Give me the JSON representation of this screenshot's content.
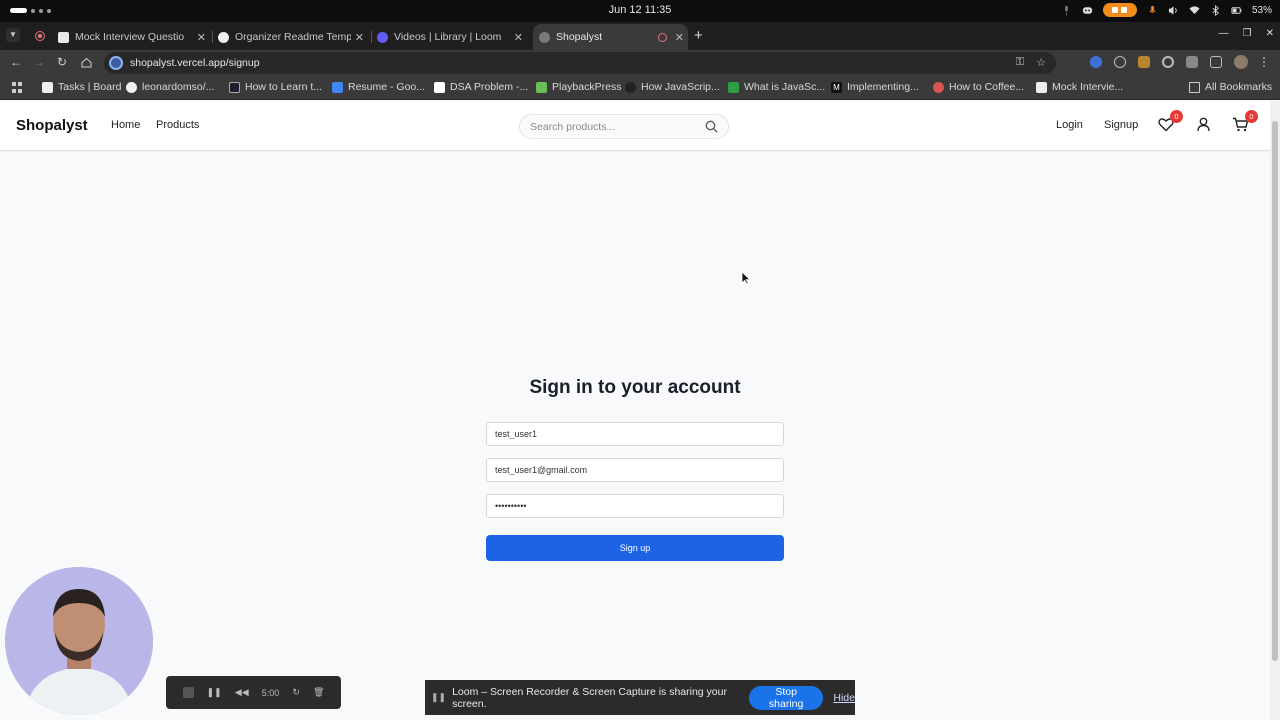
{
  "os": {
    "clock": "Jun 12  11:35",
    "battery": "53%"
  },
  "browser": {
    "tabs": [
      {
        "title": "Mock Interview Questio",
        "active": false
      },
      {
        "title": "Organizer Readme Temp",
        "active": false
      },
      {
        "title": "Videos | Library | Loom",
        "active": false
      },
      {
        "title": "Shopalyst",
        "active": true
      }
    ],
    "url": "shopalyst.vercel.app/signup",
    "bookmarks": [
      "Tasks | Board",
      "leonardomso/...",
      "How to Learn t...",
      "Resume - Goo...",
      "DSA Problem -...",
      "PlaybackPress",
      "How JavaScrip...",
      "What is JavaSc...",
      "Implementing...",
      "How to Coffee...",
      "Mock Intervie..."
    ],
    "all_bookmarks": "All Bookmarks"
  },
  "site": {
    "brand": "Shopalyst",
    "nav": {
      "home": "Home",
      "products": "Products"
    },
    "search_placeholder": "Search products...",
    "login": "Login",
    "signup": "Signup",
    "wishlist_count": "0",
    "cart_count": "0"
  },
  "form": {
    "title": "Sign in to your account",
    "username": "test_user1",
    "email": "test_user1@gmail.com",
    "password": "••••••••••",
    "submit": "Sign up"
  },
  "loom": {
    "timer": "5:00",
    "share_message": "Loom – Screen Recorder & Screen Capture is sharing your screen.",
    "stop_sharing": "Stop sharing",
    "hide": "Hide"
  }
}
